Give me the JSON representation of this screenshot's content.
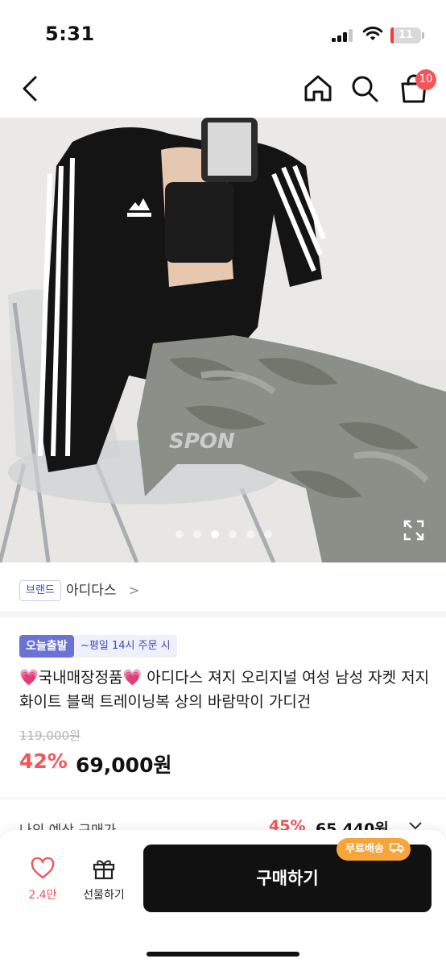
{
  "status_bar": {
    "time": "5:31",
    "battery": "11",
    "battery_level": 0.11,
    "icons": [
      "signal-icon",
      "wifi-icon",
      "battery-icon"
    ]
  },
  "nav": {
    "cart_count": "10",
    "icons": [
      "back-icon",
      "home-icon",
      "search-icon",
      "cart-icon"
    ]
  },
  "gallery": {
    "slide_count": 6,
    "active_index": 2,
    "watermark": "SPON",
    "icons": [
      "expand-icon"
    ]
  },
  "brand": {
    "tag": "브랜드",
    "name": "아디다스",
    "chevron": ">"
  },
  "product": {
    "tag_today": "오늘출발",
    "tag_time": "~평일 14시 주문 시",
    "title": "💗국내매장정품💗 아디다스 져지 오리지널 여성 남성 자켓 저지 화이트 블랙 트레이닝복 상의 바람막이 가디건",
    "original_price": "119,000원",
    "discount": "42%",
    "price": "69,000원"
  },
  "expected": {
    "label": "나의 예상 구매가",
    "discount": "45%",
    "price": "65,440원"
  },
  "bottom_bar": {
    "like_count": "2.4만",
    "gift_label": "선물하기",
    "buy_label": "구매하기",
    "free_shipping": "무료배송"
  },
  "colors": {
    "accent_red": "#f2555a",
    "tag_purple": "#6b72d6",
    "buy_button": "#111111",
    "shipping_orange": "#f7a53a"
  }
}
